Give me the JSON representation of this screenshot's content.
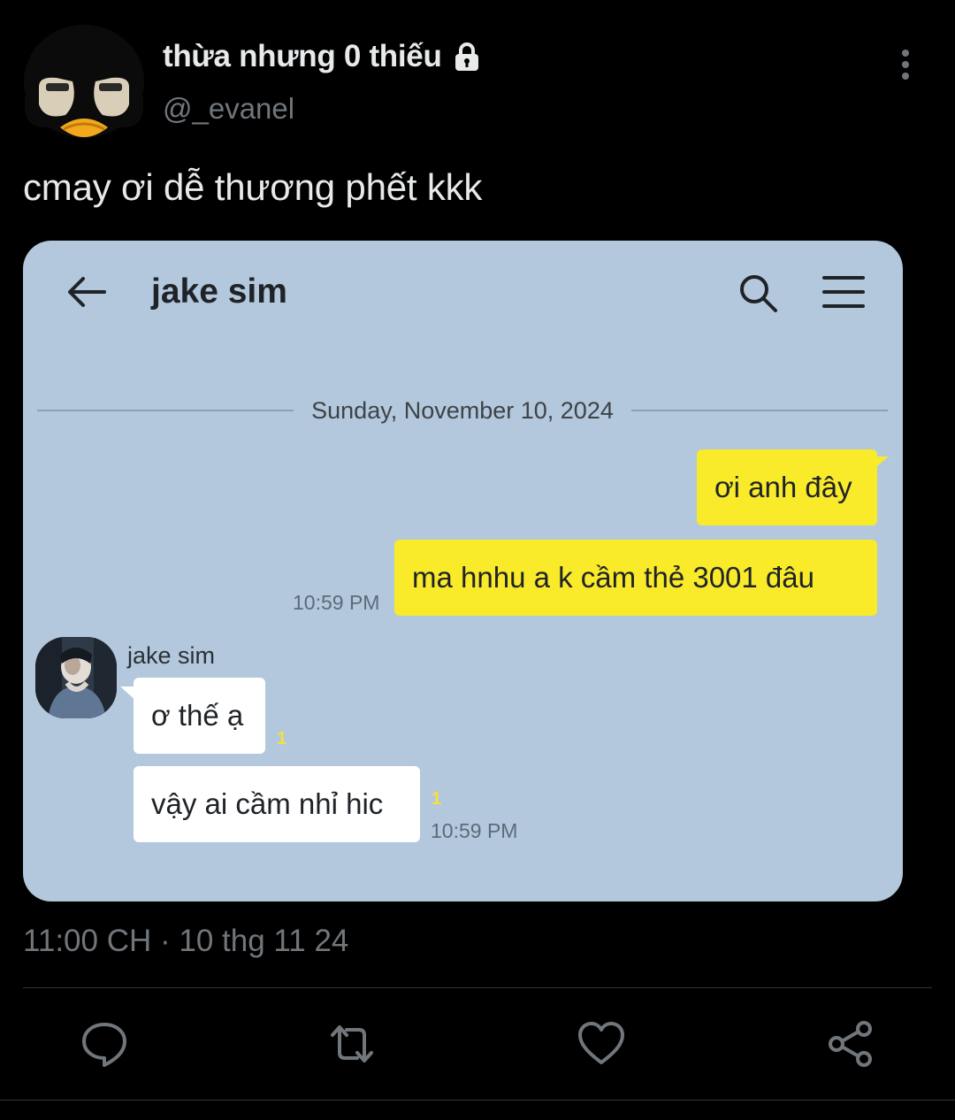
{
  "tweet": {
    "display_name": "thừa nhưng 0 thiếu",
    "handle": "@_evanel",
    "text": "cmay ơi dễ thương phết kkk",
    "timestamp": "11:00 CH · 10 thg 11 24",
    "protected_icon": "lock-icon",
    "accent_color": "#1d9bf0"
  },
  "chat": {
    "title": "jake sim",
    "date": "Sunday, November 10, 2024",
    "messages": [
      {
        "from": "me",
        "text": "ơi anh đây"
      },
      {
        "from": "me",
        "text": "ma hnhu a k cầm thẻ 3001 đâu",
        "time": "10:59 PM"
      },
      {
        "from": "them",
        "sender": "jake sim",
        "text": "ơ thế ạ",
        "unread": "1"
      },
      {
        "from": "them",
        "text": "vậy ai cầm nhỉ hic",
        "unread": "1",
        "time": "10:59 PM"
      }
    ],
    "colors": {
      "background": "#b3c8dd",
      "my_bubble": "#f9ea2a",
      "their_bubble": "#ffffff"
    }
  },
  "actions": [
    "reply-icon",
    "retweet-icon",
    "like-icon",
    "share-icon"
  ]
}
